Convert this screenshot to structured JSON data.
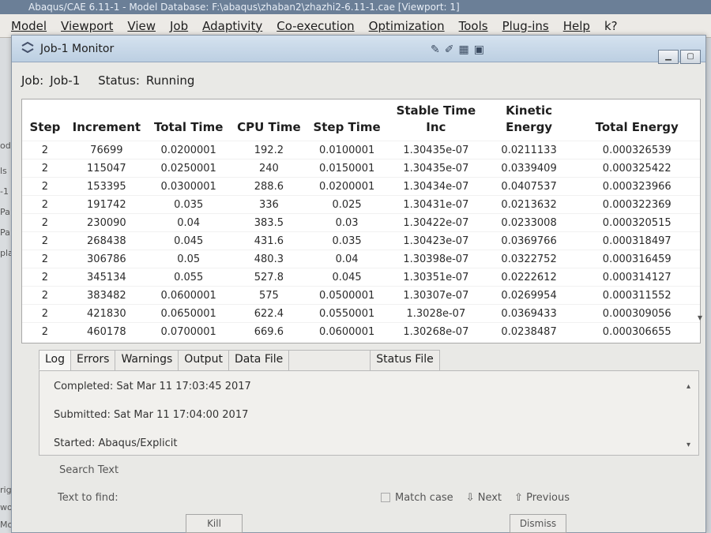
{
  "app": {
    "title": "Abaqus/CAE 6.11-1 - Model Database: F:\\abaqus\\zhaban2\\zhazhi2-6.11-1.cae [Viewport: 1]",
    "menu": [
      "Model",
      "Viewport",
      "View",
      "Job",
      "Adaptivity",
      "Co-execution",
      "Optimization",
      "Tools",
      "Plug-ins",
      "Help",
      "k?"
    ]
  },
  "left_fragments": [
    "od",
    "ls",
    "-1",
    "Pa",
    "Pa",
    "pla",
    "rig",
    "wo",
    "Mo"
  ],
  "dialog": {
    "title": "Job-1 Monitor",
    "status_label_job": "Job:",
    "job_value": "Job-1",
    "status_label": "Status:",
    "status_value": "Running",
    "columns": [
      "Step",
      "Increment",
      "Total Time",
      "CPU Time",
      "Step Time",
      "Stable Time Inc",
      "Kinetic Energy",
      "Total Energy"
    ],
    "rows": [
      [
        "2",
        "76699",
        "0.0200001",
        "192.2",
        "0.0100001",
        "1.30435e-07",
        "0.0211133",
        "0.000326539"
      ],
      [
        "2",
        "115047",
        "0.0250001",
        "240",
        "0.0150001",
        "1.30435e-07",
        "0.0339409",
        "0.000325422"
      ],
      [
        "2",
        "153395",
        "0.0300001",
        "288.6",
        "0.0200001",
        "1.30434e-07",
        "0.0407537",
        "0.000323966"
      ],
      [
        "2",
        "191742",
        "0.035",
        "336",
        "0.025",
        "1.30431e-07",
        "0.0213632",
        "0.000322369"
      ],
      [
        "2",
        "230090",
        "0.04",
        "383.5",
        "0.03",
        "1.30422e-07",
        "0.0233008",
        "0.000320515"
      ],
      [
        "2",
        "268438",
        "0.045",
        "431.6",
        "0.035",
        "1.30423e-07",
        "0.0369766",
        "0.000318497"
      ],
      [
        "2",
        "306786",
        "0.05",
        "480.3",
        "0.04",
        "1.30398e-07",
        "0.0322752",
        "0.000316459"
      ],
      [
        "2",
        "345134",
        "0.055",
        "527.8",
        "0.045",
        "1.30351e-07",
        "0.0222612",
        "0.000314127"
      ],
      [
        "2",
        "383482",
        "0.0600001",
        "575",
        "0.0500001",
        "1.30307e-07",
        "0.0269954",
        "0.000311552"
      ],
      [
        "2",
        "421830",
        "0.0650001",
        "622.4",
        "0.0550001",
        "1.3028e-07",
        "0.0369433",
        "0.000309056"
      ],
      [
        "2",
        "460178",
        "0.0700001",
        "669.6",
        "0.0600001",
        "1.30268e-07",
        "0.0238487",
        "0.000306655"
      ]
    ],
    "tabs": [
      "Log",
      "Errors",
      "Warnings",
      "Output",
      "Data File",
      "",
      "Status File"
    ],
    "log_lines": [
      "Completed: Sat Mar 11 17:03:45 2017",
      "Submitted: Sat Mar 11 17:04:00 2017",
      "Started:   Abaqus/Explicit"
    ],
    "search_title": "Search Text",
    "search_label": "Text to find:",
    "match_case": "Match case",
    "next": "Next",
    "previous": "Previous",
    "kill": "Kill",
    "dismiss": "Dismiss"
  }
}
